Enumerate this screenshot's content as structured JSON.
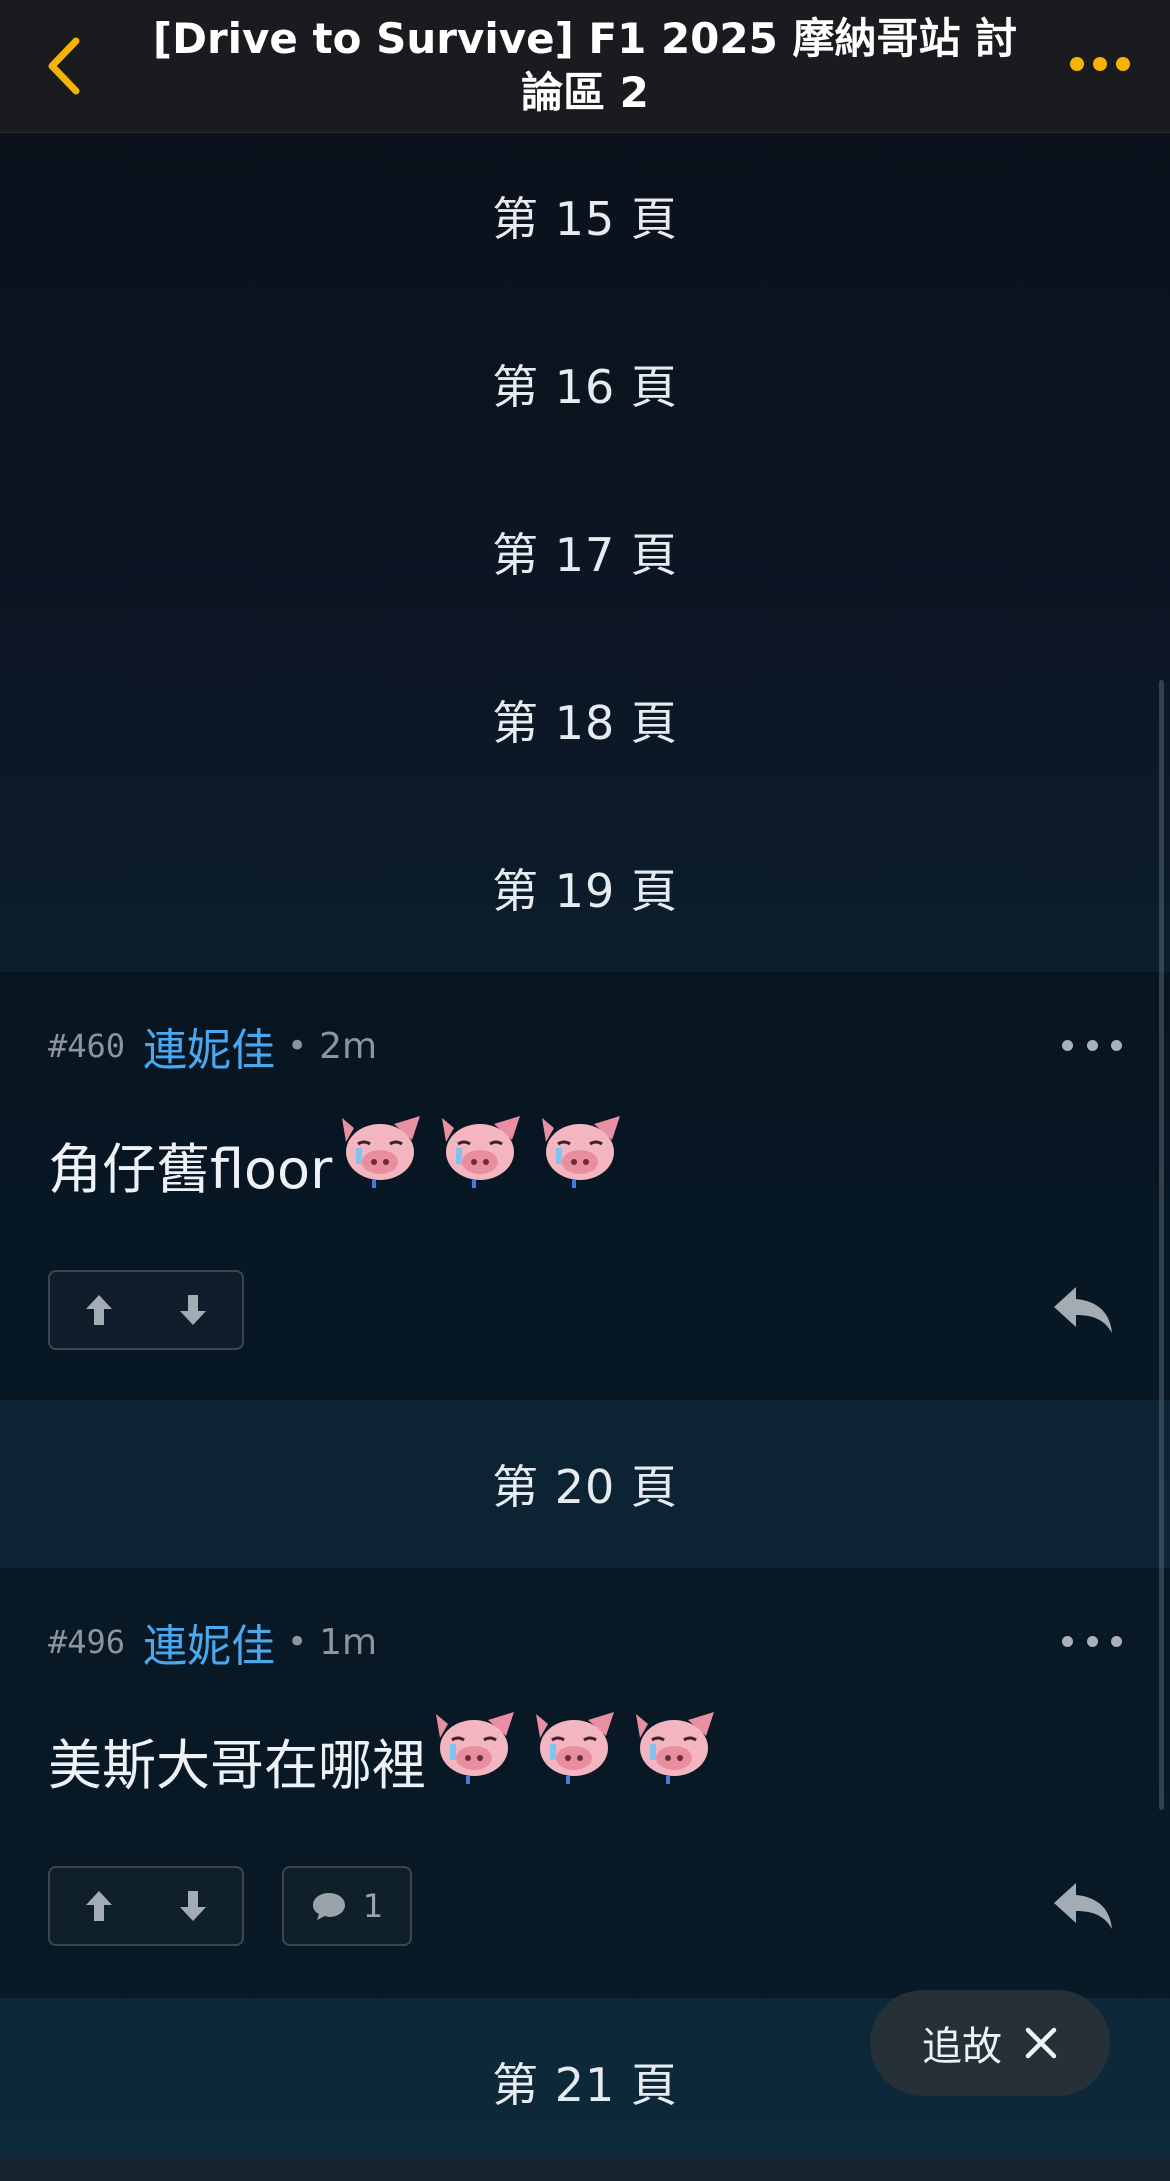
{
  "header": {
    "title": "[Drive to Survive] F1 2025 摩納哥站 討論區 2",
    "back_icon": "chevron-left-icon",
    "more_icon": "more-horizontal-icon",
    "accent": "#f5b400"
  },
  "pages": {
    "p15": "第 15 頁",
    "p16": "第 16 頁",
    "p17": "第 17 頁",
    "p18": "第 18 頁",
    "p19": "第 19 頁",
    "p20": "第 20 頁",
    "p21": "第 21 頁"
  },
  "posts": [
    {
      "number": "#460",
      "user": "連妮佳",
      "separator": "•",
      "time": "2m",
      "text": "角仔舊floor",
      "emoji": "crying-pig-emoji",
      "emoji_count": 3,
      "reply_count": null
    },
    {
      "number": "#496",
      "user": "連妮佳",
      "separator": "•",
      "time": "1m",
      "text": "美斯大哥在哪裡",
      "emoji": "crying-pig-emoji",
      "emoji_count": 3,
      "reply_count": "1"
    }
  ],
  "follow": {
    "label": "追故",
    "close_icon": "close-icon"
  },
  "colors": {
    "username": "#4aa8f0",
    "muted": "#8d949c"
  }
}
